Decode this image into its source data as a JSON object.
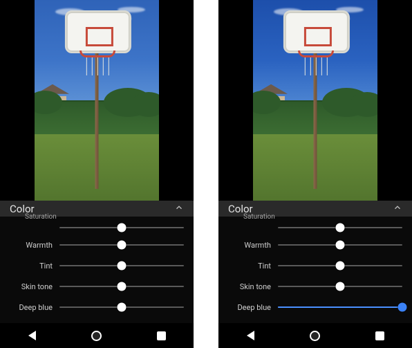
{
  "panelA": {
    "section_title": "Color",
    "sliders": [
      {
        "label": "Saturation",
        "value": 50,
        "active": false,
        "truncated": true
      },
      {
        "label": "Warmth",
        "value": 50,
        "active": false,
        "truncated": false
      },
      {
        "label": "Tint",
        "value": 50,
        "active": false,
        "truncated": false
      },
      {
        "label": "Skin tone",
        "value": 50,
        "active": false,
        "truncated": false
      },
      {
        "label": "Deep blue",
        "value": 50,
        "active": false,
        "truncated": false
      }
    ]
  },
  "panelB": {
    "section_title": "Color",
    "sliders": [
      {
        "label": "Saturation",
        "value": 50,
        "active": false,
        "truncated": true
      },
      {
        "label": "Warmth",
        "value": 50,
        "active": false,
        "truncated": false
      },
      {
        "label": "Tint",
        "value": 50,
        "active": false,
        "truncated": false
      },
      {
        "label": "Skin tone",
        "value": 50,
        "active": false,
        "truncated": false
      },
      {
        "label": "Deep blue",
        "value": 100,
        "active": true,
        "truncated": false
      }
    ]
  },
  "colors": {
    "accent": "#3b82f6"
  }
}
